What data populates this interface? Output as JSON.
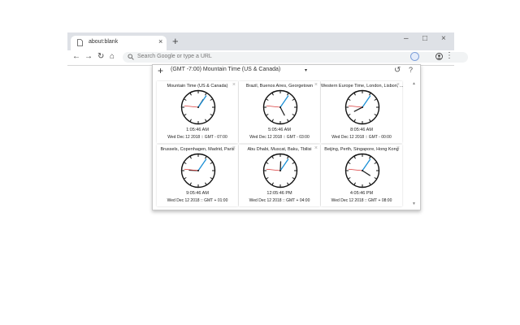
{
  "browser": {
    "tab_title": "about:blank",
    "tab_close": "×",
    "new_tab": "+",
    "window_controls": {
      "minimize": "–",
      "maximize": "□",
      "close": "×"
    },
    "nav": {
      "back": "←",
      "forward": "→",
      "reload": "↻",
      "home": "⌂"
    },
    "omnibox_placeholder": "Search Google or type a URL",
    "menu": "⋮",
    "icons": [
      "doc-icon",
      "search-icon",
      "extension-icon",
      "profile-icon"
    ]
  },
  "popup": {
    "add_label": "+",
    "timezone_selected": "(GMT -7:00) Mountain Time (US & Canada)",
    "caret": "▾",
    "refresh": "↺",
    "help": "?",
    "scroll_up": "▲",
    "scroll_down": "▼",
    "close_label": "×",
    "colors": {
      "hour_hand": "#222222",
      "minute_hand": "#1a8fd6",
      "second_hand": "#d93a3a"
    },
    "clocks": [
      {
        "name": "Mountain Time (US & Canada)",
        "time": "1:05:46 AM",
        "date": "Wed Dec 12 2018 :: GMT - 07:00",
        "h": 1,
        "m": 5,
        "s": 46
      },
      {
        "name": "Brazil, Buenos Aires, Georgetown",
        "time": "5:05:46 AM",
        "date": "Wed Dec 12 2018 :: GMT - 03:00",
        "h": 5,
        "m": 5,
        "s": 46
      },
      {
        "name": "Western Europe Time, London, Lisbon, ...",
        "time": "8:05:46 AM",
        "date": "Wed Dec 12 2018 :: GMT - 00:00",
        "h": 8,
        "m": 5,
        "s": 46
      },
      {
        "name": "Brussels, Copenhagen, Madrid, Paris",
        "time": "9:05:46 AM",
        "date": "Wed Dec 12 2018 :: GMT + 01:00",
        "h": 9,
        "m": 5,
        "s": 46
      },
      {
        "name": "Abu Dhabi, Muscat, Baku, Tbilisi",
        "time": "12:05:46 PM",
        "date": "Wed Dec 12 2018 :: GMT + 04:00",
        "h": 12,
        "m": 5,
        "s": 46
      },
      {
        "name": "Beijing, Perth, Singapore, Hong Kong",
        "time": "4:05:46 PM",
        "date": "Wed Dec 12 2018 :: GMT + 08:00",
        "h": 4,
        "m": 5,
        "s": 46
      }
    ]
  }
}
